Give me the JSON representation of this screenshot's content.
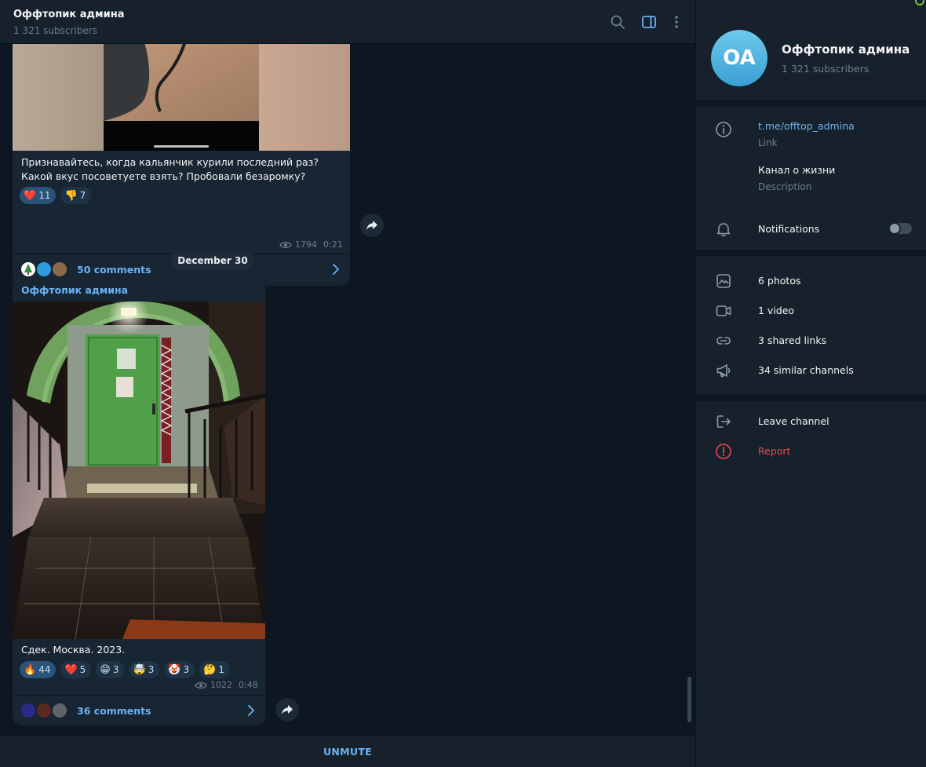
{
  "header": {
    "title": "Оффтопик админа",
    "subscribers": "1 321 subscribers"
  },
  "colors": {
    "app_bg": "#0e1621",
    "panel_bg": "#17212b",
    "bubble_bg": "#182533",
    "accent": "#6ab3f3",
    "report_red": "#e5484d",
    "avatar_blue": "#47a8db"
  },
  "messages": [
    {
      "caption": "Признавайтесь, когда кальянчик курили последний раз? Какой вкус посоветуете взять? Пробовали безаромку?",
      "reactions": [
        {
          "emoji": "❤️",
          "count": "11"
        },
        {
          "emoji": "👎",
          "count": "7"
        }
      ],
      "views": "1794",
      "time": "0:21",
      "comments": "50 comments"
    },
    {
      "author": "Оффтопик админа",
      "caption": "Сдек. Москва. 2023.",
      "reactions": [
        {
          "emoji": "🔥",
          "count": "44"
        },
        {
          "emoji": "❤️",
          "count": "5"
        },
        {
          "emoji": "😁",
          "count": "3"
        },
        {
          "emoji": "🤯",
          "count": "3"
        },
        {
          "emoji": "🤡",
          "count": "3"
        },
        {
          "emoji": "🤔",
          "count": "1"
        }
      ],
      "views": "1022",
      "time": "0:48",
      "comments": "36 comments"
    }
  ],
  "date_separator": "December 30",
  "bottom_bar": {
    "button": "UNMUTE"
  },
  "info": {
    "avatar_initials": "OA",
    "name": "Оффтопик админа",
    "subscribers": "1 321 subscribers",
    "link": "t.me/offtop_admina",
    "link_label": "Link",
    "description": "Канал о жизни",
    "description_label": "Description",
    "notifications": "Notifications",
    "notifications_on": false,
    "media": {
      "photos": "6 photos",
      "videos": "1 video",
      "links": "3 shared links",
      "similar": "34 similar channels"
    },
    "leave": "Leave channel",
    "report": "Report"
  }
}
